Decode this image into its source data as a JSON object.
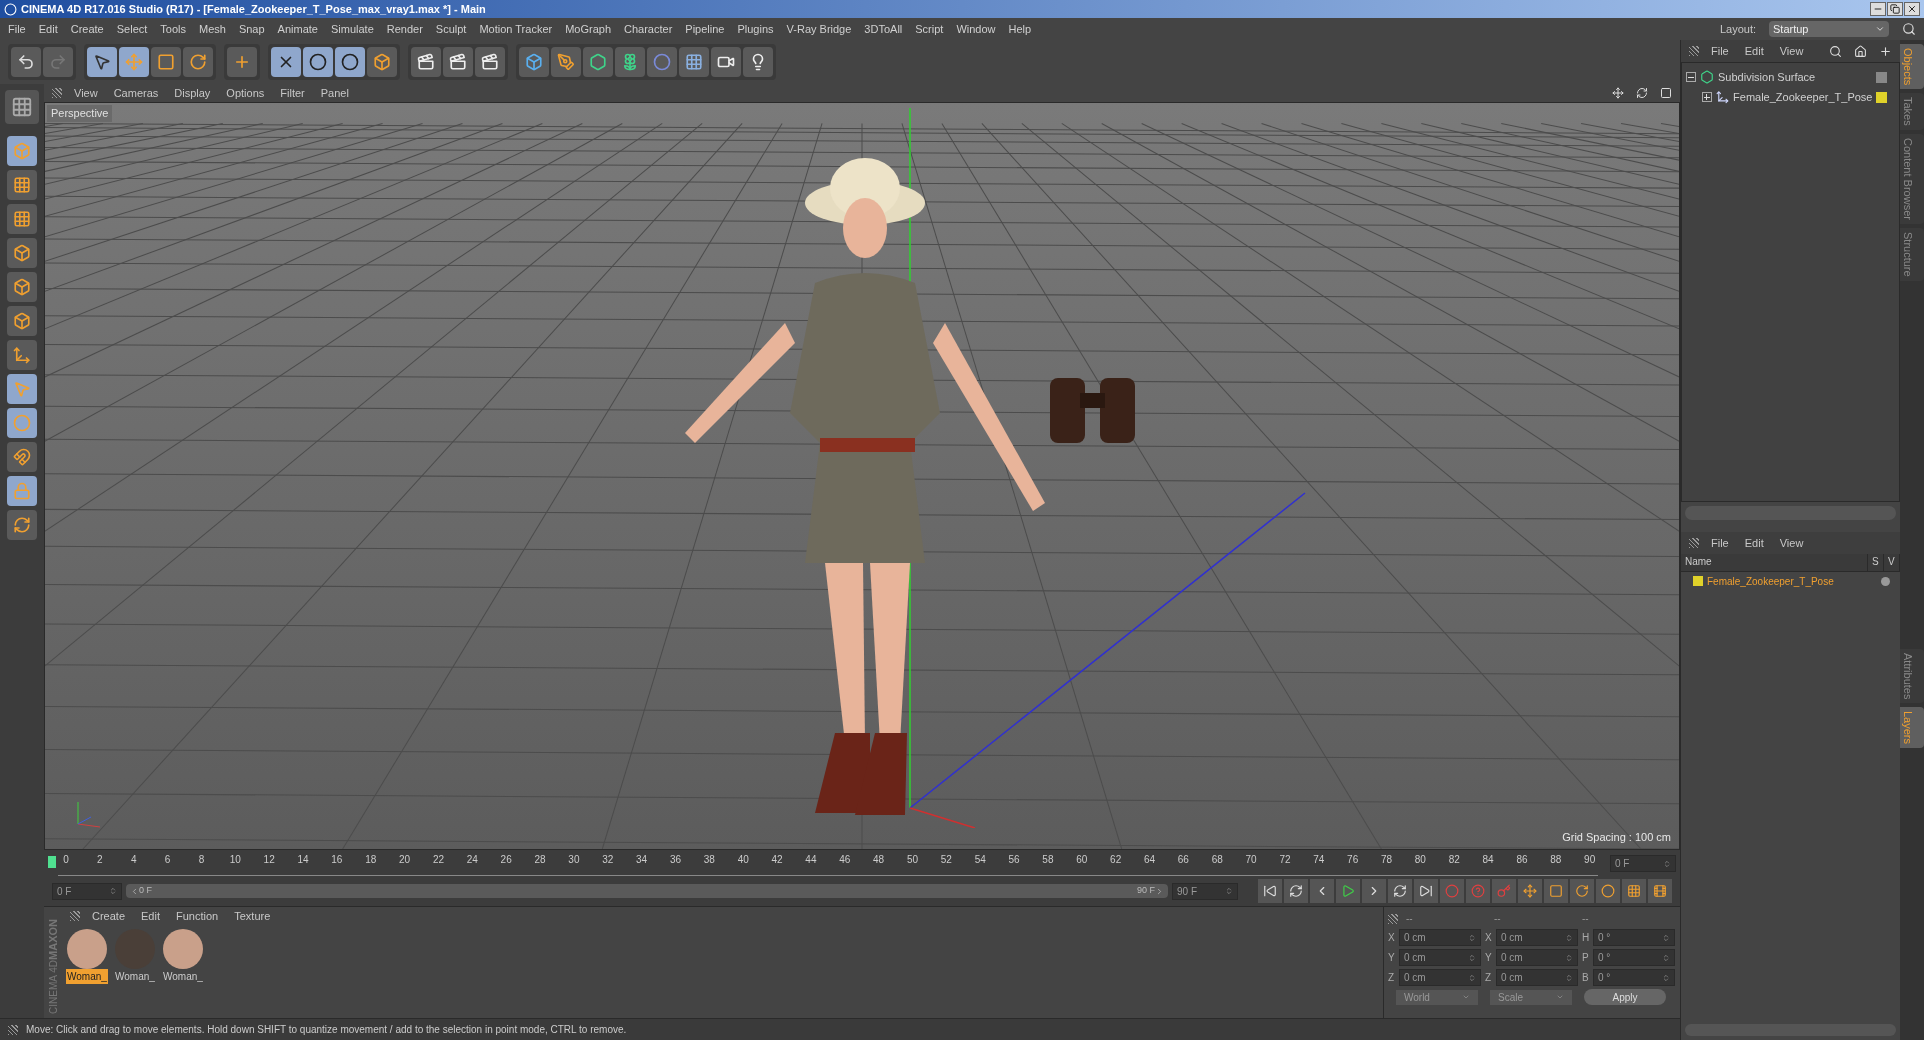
{
  "window": {
    "title": "CINEMA 4D R17.016 Studio (R17) - [Female_Zookeeper_T_Pose_max_vray1.max *] - Main"
  },
  "menu": [
    "File",
    "Edit",
    "Create",
    "Select",
    "Tools",
    "Mesh",
    "Snap",
    "Animate",
    "Simulate",
    "Render",
    "Sculpt",
    "Motion Tracker",
    "MoGraph",
    "Character",
    "Pipeline",
    "Plugins",
    "V-Ray Bridge",
    "3DToAll",
    "Script",
    "Window",
    "Help"
  ],
  "layout": {
    "label": "Layout:",
    "value": "Startup"
  },
  "viewport": {
    "menu": [
      "View",
      "Cameras",
      "Display",
      "Options",
      "Filter",
      "Panel"
    ],
    "camera": "Perspective",
    "grid_spacing": "Grid Spacing : 100 cm"
  },
  "objects_panel": {
    "menu": [
      "File",
      "Edit",
      "View"
    ],
    "tree": [
      {
        "name": "Subdivision Surface",
        "kind": "generator",
        "expanded": true,
        "children": [
          {
            "name": "Female_Zookeeper_T_Pose",
            "kind": "null",
            "expanded": false,
            "color": "#e0d22a"
          }
        ]
      }
    ]
  },
  "side_tabs": [
    {
      "label": "Objects",
      "selected": true
    },
    {
      "label": "Takes",
      "selected": false
    },
    {
      "label": "Content Browser",
      "selected": false
    },
    {
      "label": "Structure",
      "selected": false
    }
  ],
  "layers_panel": {
    "menu": [
      "File",
      "Edit",
      "View"
    ],
    "columns": [
      "Name",
      "S",
      "V"
    ],
    "rows": [
      {
        "name": "Female_Zookeeper_T_Pose",
        "color": "#e0d22a"
      }
    ]
  },
  "lower_side_tabs": [
    {
      "label": "Attributes",
      "selected": false
    },
    {
      "label": "Layers",
      "selected": true
    }
  ],
  "timeline": {
    "ticks": [
      "0",
      "2",
      "4",
      "6",
      "8",
      "10",
      "12",
      "14",
      "16",
      "18",
      "20",
      "22",
      "24",
      "26",
      "28",
      "30",
      "32",
      "34",
      "36",
      "38",
      "40",
      "42",
      "44",
      "46",
      "48",
      "50",
      "52",
      "54",
      "56",
      "58",
      "60",
      "62",
      "64",
      "66",
      "68",
      "70",
      "72",
      "74",
      "76",
      "78",
      "80",
      "82",
      "84",
      "86",
      "88",
      "90"
    ],
    "current": "0 F"
  },
  "transport": {
    "start": "0 F",
    "slider_start": "0 F",
    "slider_end": "90 F",
    "level": 1,
    "end": "90 F"
  },
  "materials": {
    "menu": [
      "Create",
      "Edit",
      "Function",
      "Texture"
    ],
    "items": [
      {
        "label": "Woman_",
        "selected": true,
        "color": "#c9a08a"
      },
      {
        "label": "Woman_",
        "selected": false,
        "color": "#4a3f38"
      },
      {
        "label": "Woman_",
        "selected": false,
        "color": "#c9a08a"
      }
    ]
  },
  "coordinates": {
    "headers": [
      "--",
      "--",
      "--"
    ],
    "rows": [
      [
        {
          "axis": "X",
          "value": "0 cm"
        },
        {
          "axis": "X",
          "value": "0 cm"
        },
        {
          "axis": "H",
          "value": "0 °"
        }
      ],
      [
        {
          "axis": "Y",
          "value": "0 cm"
        },
        {
          "axis": "Y",
          "value": "0 cm"
        },
        {
          "axis": "P",
          "value": "0 °"
        }
      ],
      [
        {
          "axis": "Z",
          "value": "0 cm"
        },
        {
          "axis": "Z",
          "value": "0 cm"
        },
        {
          "axis": "B",
          "value": "0 °"
        }
      ]
    ],
    "mode": "World",
    "size_mode": "Scale",
    "apply": "Apply"
  },
  "brand": {
    "line_1": "MAXON",
    "line_2": "CINEMA 4D"
  },
  "status_bar": "Move: Click and drag to move elements. Hold down SHIFT to quantize movement / add to the selection in point mode, CTRL to remove."
}
